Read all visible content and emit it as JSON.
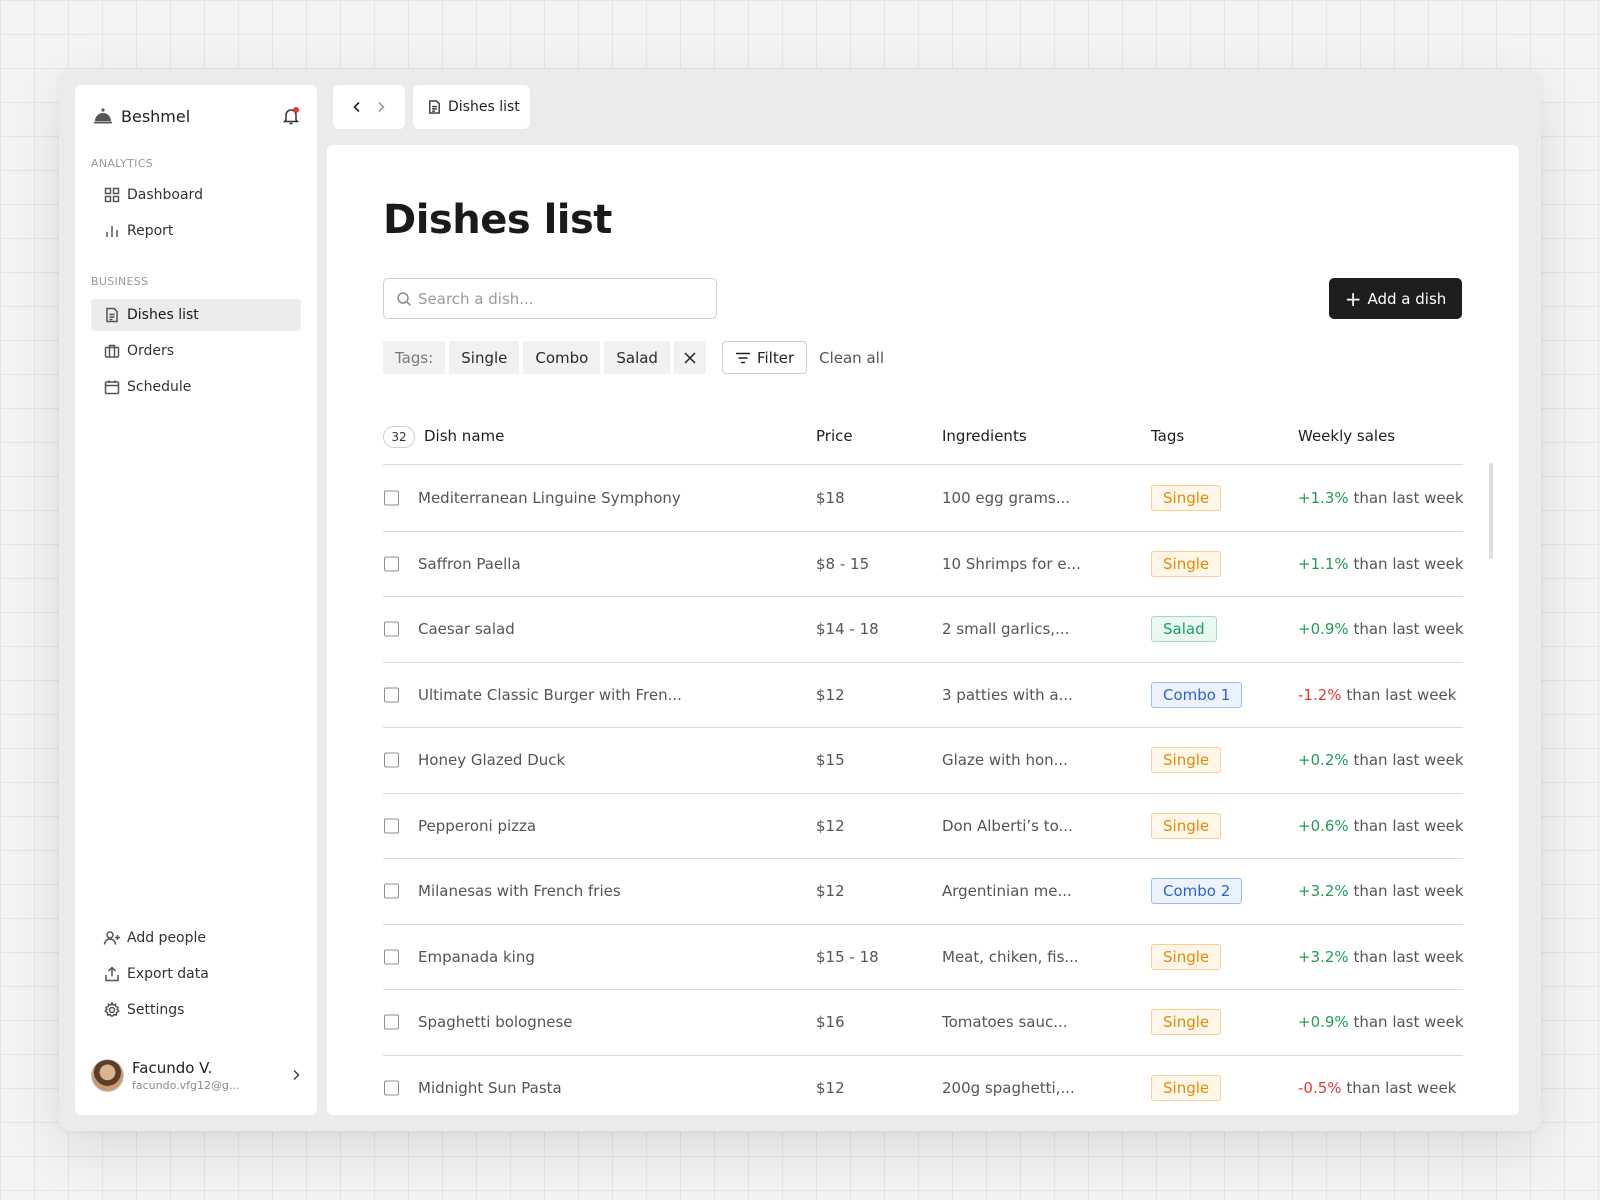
{
  "sidebar": {
    "brand": "Beshmel",
    "sections": [
      {
        "title": "ANALYTICS",
        "items": [
          {
            "label": "Dashboard",
            "icon": "grid-icon"
          },
          {
            "label": "Report",
            "icon": "bar-chart-icon"
          }
        ]
      },
      {
        "title": "BUSINESS",
        "items": [
          {
            "label": "Dishes list",
            "icon": "document-icon"
          },
          {
            "label": "Orders",
            "icon": "briefcase-icon"
          },
          {
            "label": "Schedule",
            "icon": "calendar-icon"
          }
        ]
      }
    ],
    "footer_items": [
      {
        "label": "Add people",
        "icon": "add-user-icon"
      },
      {
        "label": "Export data",
        "icon": "upload-icon"
      },
      {
        "label": "Settings",
        "icon": "gear-icon"
      }
    ],
    "user": {
      "name": "Facundo V.",
      "email": "facundo.vfg12@g..."
    }
  },
  "topbar": {
    "tab_label": "Dishes list"
  },
  "main": {
    "title": "Dishes list",
    "search_placeholder": "Search a dish...",
    "add_button": "Add a dish",
    "tags_label": "Tags:",
    "tag_chips": [
      "Single",
      "Combo",
      "Salad"
    ],
    "filter_label": "Filter",
    "clear_label": "Clean all"
  },
  "table": {
    "count": "32",
    "headers": {
      "name": "Dish name",
      "price": "Price",
      "ingredients": "Ingredients",
      "tags": "Tags",
      "sales": "Weekly sales"
    },
    "sales_suffix": "than last week",
    "rows": [
      {
        "name": "Mediterranean Linguine Symphony",
        "price": "$18",
        "ingredients": "100 egg grams...",
        "tag": "Single",
        "sales": "+1.3%"
      },
      {
        "name": "Saffron Paella",
        "price": "$8 - 15",
        "ingredients": "10 Shrimps for e...",
        "tag": "Single",
        "sales": "+1.1%"
      },
      {
        "name": "Caesar salad",
        "price": "$14 - 18",
        "ingredients": "2 small garlics,...",
        "tag": "Salad",
        "sales": "+0.9%"
      },
      {
        "name": "Ultimate Classic Burger with Fren...",
        "price": "$12",
        "ingredients": "3 patties with a...",
        "tag": "Combo 1",
        "sales": "-1.2%"
      },
      {
        "name": "Honey Glazed Duck",
        "price": "$15",
        "ingredients": "Glaze with hon...",
        "tag": "Single",
        "sales": "+0.2%"
      },
      {
        "name": "Pepperoni pizza",
        "price": "$12",
        "ingredients": "Don Alberti’s to...",
        "tag": "Single",
        "sales": "+0.6%"
      },
      {
        "name": "Milanesas with French fries",
        "price": "$12",
        "ingredients": "Argentinian me...",
        "tag": "Combo 2",
        "sales": "+3.2%"
      },
      {
        "name": "Empanada king",
        "price": "$15 - 18",
        "ingredients": "Meat, chiken, fis...",
        "tag": "Single",
        "sales": "+3.2%"
      },
      {
        "name": "Spaghetti bolognese",
        "price": "$16",
        "ingredients": "Tomatoes sauc...",
        "tag": "Single",
        "sales": "+0.9%"
      },
      {
        "name": "Midnight Sun Pasta",
        "price": "$12",
        "ingredients": "200g spaghetti,...",
        "tag": "Single",
        "sales": "-0.5%"
      }
    ]
  },
  "colors": {
    "tag_single": {
      "fg": "#e08a0b",
      "bg": "#fff6e8",
      "border": "#f6cf96"
    },
    "tag_salad": {
      "fg": "#17a06a",
      "bg": "#eaf8f1",
      "border": "#9fdcc0"
    },
    "tag_combo": {
      "fg": "#2a63c9",
      "bg": "#edf3fd",
      "border": "#9dbbee"
    },
    "positive": "#1f9d55",
    "negative": "#e53935",
    "primary_button": "#1e1e1e"
  }
}
